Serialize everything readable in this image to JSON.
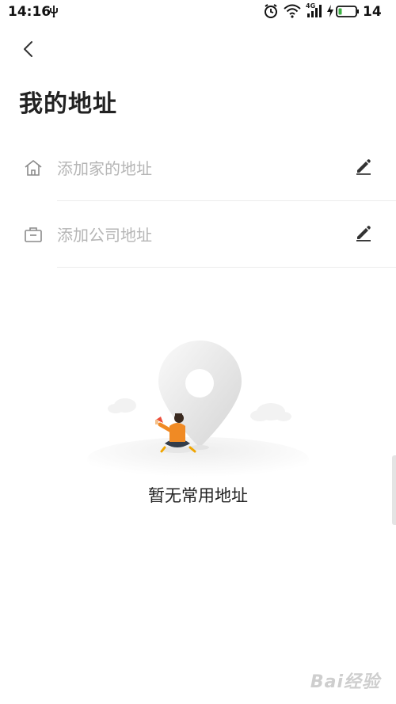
{
  "status_bar": {
    "time": "14:16",
    "network_label": "4G",
    "battery_level": "14"
  },
  "header": {
    "title": "我的地址"
  },
  "addresses": [
    {
      "label": "添加家的地址",
      "icon": "home-icon"
    },
    {
      "label": "添加公司地址",
      "icon": "briefcase-icon"
    }
  ],
  "empty_state": {
    "message": "暂无常用地址"
  },
  "watermark": {
    "text": "Bai经验"
  },
  "colors": {
    "accent": "#f08a24",
    "placeholder_text": "#b5b5b5",
    "divider": "#ececec"
  }
}
